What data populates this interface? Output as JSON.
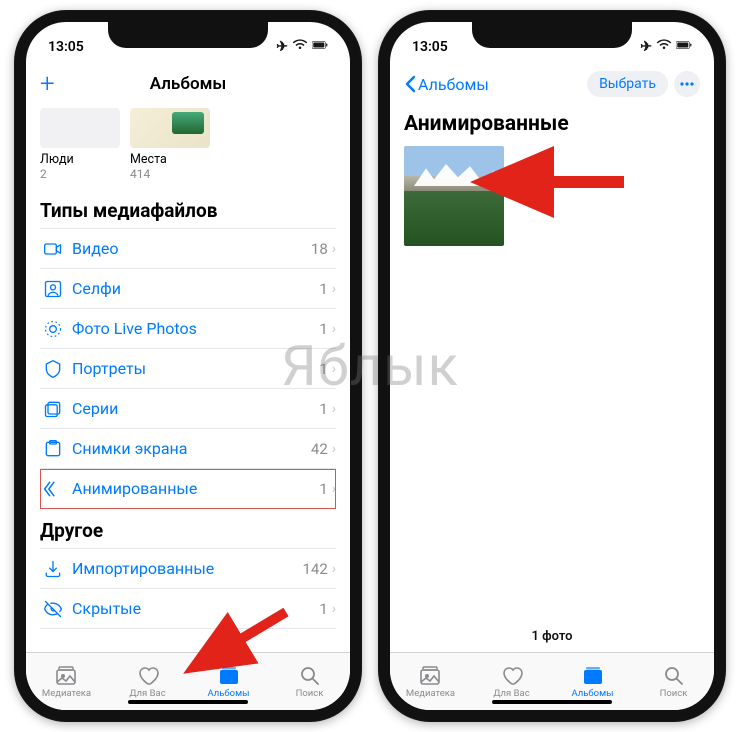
{
  "watermark": "Яблык",
  "status": {
    "time": "13:05"
  },
  "phone1": {
    "nav": {
      "title": "Альбомы",
      "add": "+"
    },
    "albums": [
      {
        "label": "Люди",
        "count": "2"
      },
      {
        "label": "Места",
        "count": "414"
      }
    ],
    "section_media_types": "Типы медиафайлов",
    "media_types": [
      {
        "icon": "video",
        "label": "Видео",
        "count": "18"
      },
      {
        "icon": "selfie",
        "label": "Селфи",
        "count": "1"
      },
      {
        "icon": "livephoto",
        "label": "Фото Live Photos",
        "count": "1"
      },
      {
        "icon": "portrait",
        "label": "Портреты",
        "count": "1"
      },
      {
        "icon": "burst",
        "label": "Серии",
        "count": "1"
      },
      {
        "icon": "screenshot",
        "label": "Снимки экрана",
        "count": "42"
      },
      {
        "icon": "animated",
        "label": "Анимированные",
        "count": "1",
        "highlight": true
      }
    ],
    "section_other": "Другое",
    "other": [
      {
        "icon": "import",
        "label": "Импортированные",
        "count": "142"
      },
      {
        "icon": "hidden",
        "label": "Скрытые",
        "count": "1"
      }
    ]
  },
  "phone2": {
    "nav": {
      "back": "Альбомы",
      "select": "Выбрать"
    },
    "title": "Анимированные",
    "footer": "1 фото"
  },
  "tabs": [
    {
      "icon": "library",
      "label": "Медиатека"
    },
    {
      "icon": "foryou",
      "label": "Для Вас"
    },
    {
      "icon": "albums",
      "label": "Альбомы",
      "active": true
    },
    {
      "icon": "search",
      "label": "Поиск"
    }
  ]
}
